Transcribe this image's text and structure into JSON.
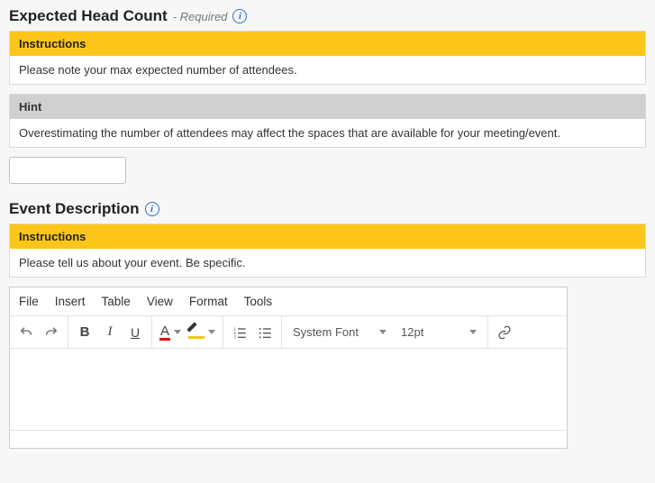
{
  "headcount": {
    "title": "Expected Head Count",
    "required_suffix": "- Required",
    "instructions_header": "Instructions",
    "instructions_body": "Please note your max expected number of attendees.",
    "hint_header": "Hint",
    "hint_body": "Overestimating the number of attendees may affect the spaces that are available for your meeting/event.",
    "value": ""
  },
  "description": {
    "title": "Event Description",
    "instructions_header": "Instructions",
    "instructions_body": "Please tell us about your event. Be specific."
  },
  "editor": {
    "menu": {
      "file": "File",
      "insert": "Insert",
      "table": "Table",
      "view": "View",
      "format": "Format",
      "tools": "Tools"
    },
    "font_family": "System Font",
    "font_size": "12pt",
    "content": ""
  }
}
